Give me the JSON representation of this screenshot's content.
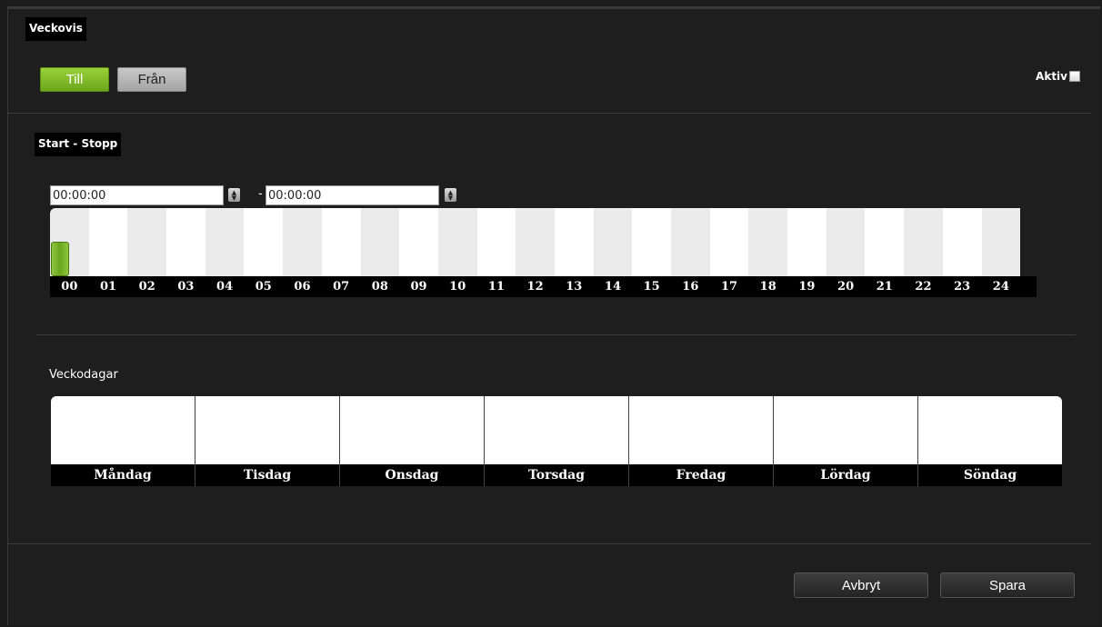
{
  "header": {
    "title": "Veckovis"
  },
  "mode_toggle": {
    "till_label": "Till",
    "fran_label": "Från",
    "selected": "Till"
  },
  "aktiv": {
    "label": "Aktiv",
    "checked": false
  },
  "schedule": {
    "section_title": "Start - Stopp",
    "start_value": "00:00:00",
    "separator": "-",
    "stop_value": "00:00:00",
    "hours": [
      "00",
      "01",
      "02",
      "03",
      "04",
      "05",
      "06",
      "07",
      "08",
      "09",
      "10",
      "11",
      "12",
      "13",
      "14",
      "15",
      "16",
      "17",
      "18",
      "19",
      "20",
      "21",
      "22",
      "23",
      "24"
    ]
  },
  "weekdays": {
    "section_title": "Veckodagar",
    "days": [
      "Måndag",
      "Tisdag",
      "Onsdag",
      "Torsdag",
      "Fredag",
      "Lördag",
      "Söndag"
    ]
  },
  "footer": {
    "cancel_label": "Avbryt",
    "save_label": "Spara"
  },
  "colors": {
    "accent": "#7ab82a",
    "background": "#1e1e1e",
    "stripe_light": "#ffffff",
    "stripe_gray": "#ebebeb"
  }
}
